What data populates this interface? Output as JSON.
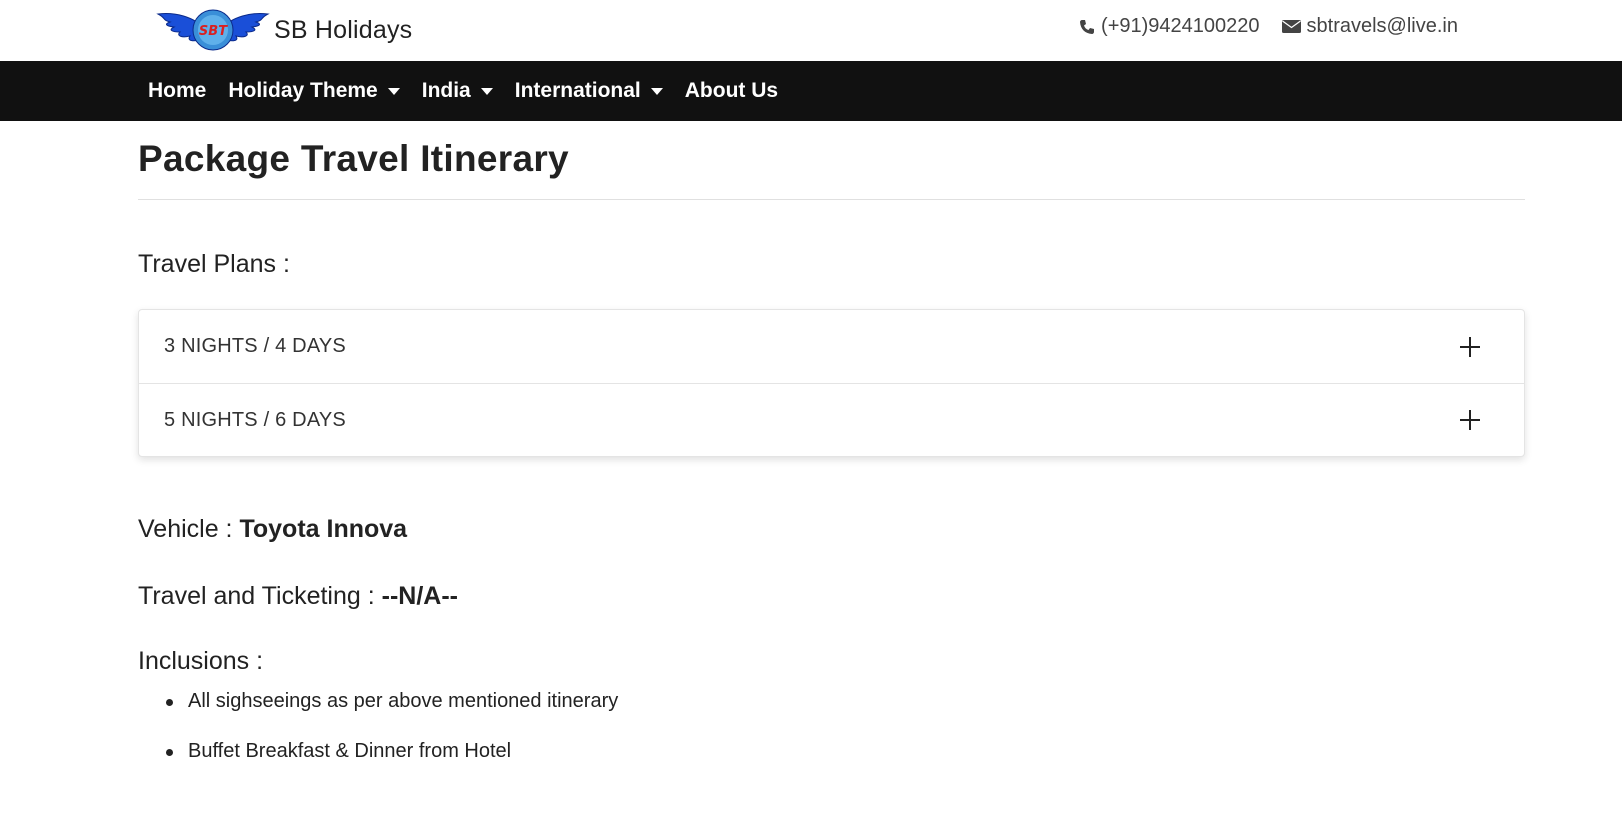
{
  "header": {
    "brand_logo_text": "SBT",
    "brand_name": "SB Holidays",
    "phone": "(+91)9424100220",
    "email": "sbtravels@live.in"
  },
  "nav": {
    "items": [
      {
        "label": "Home",
        "dropdown": false
      },
      {
        "label": "Holiday Theme",
        "dropdown": true
      },
      {
        "label": "India",
        "dropdown": true
      },
      {
        "label": "International",
        "dropdown": true
      },
      {
        "label": "About Us",
        "dropdown": false
      }
    ]
  },
  "main": {
    "title": "Package Travel Itinerary",
    "plans_label": "Travel Plans :",
    "plans": [
      {
        "title": "3 NIGHTS / 4 DAYS",
        "icon": "plus-icon"
      },
      {
        "title": "5 NIGHTS / 6 DAYS",
        "icon": "plus-icon"
      }
    ],
    "vehicle_label": "Vehicle :",
    "vehicle_value": "Toyota Innova",
    "ticketing_label": "Travel and Ticketing :",
    "ticketing_value": "--N/A--",
    "inclusions_label": "Inclusions :",
    "inclusions": [
      "All sighseeings as per above mentioned itinerary",
      "Buffet Breakfast & Dinner from Hotel"
    ]
  },
  "colors": {
    "navbar_bg": "#111111",
    "text": "#222222",
    "logo_blue": "#1a4fd8",
    "logo_red": "#d92020"
  }
}
